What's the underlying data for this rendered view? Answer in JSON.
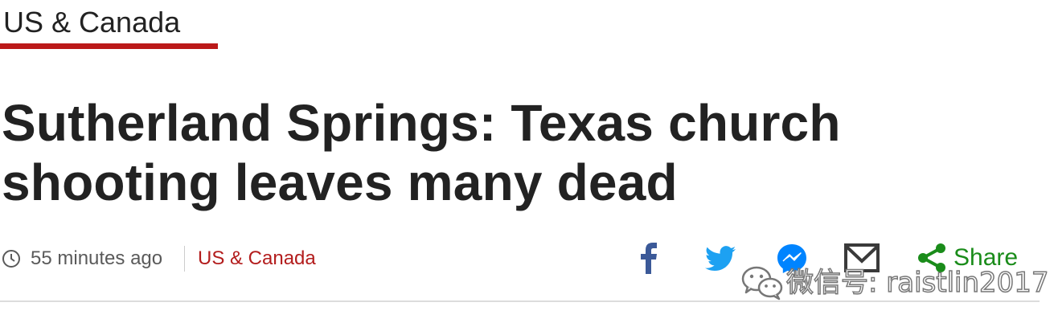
{
  "section_nav": {
    "label": "US & Canada"
  },
  "headline": "Sutherland Springs: Texas church shooting leaves many dead",
  "meta": {
    "timestamp": "55 minutes ago",
    "section_link": "US & Canada"
  },
  "share": {
    "icons": [
      "facebook-icon",
      "twitter-icon",
      "messenger-icon",
      "email-icon",
      "share-icon"
    ],
    "label": "Share"
  },
  "watermark": {
    "text": "微信号: raistlin2017"
  },
  "colors": {
    "accent_red": "#bb1919",
    "section_link_red": "#b31d1d",
    "facebook": "#3b5998",
    "twitter": "#1da1f2",
    "messenger": "#0084ff",
    "share_green": "#1a8c1a",
    "text": "#222222"
  }
}
